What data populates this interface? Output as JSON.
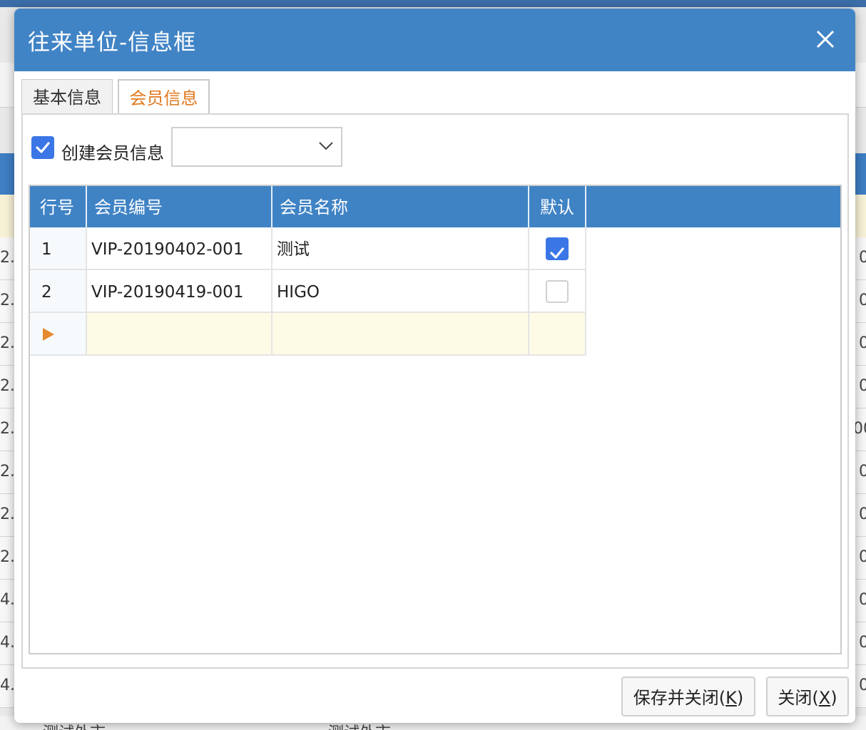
{
  "background": {
    "row_left_fragments": [
      "2.",
      "2.",
      "2.",
      "2.",
      "2.",
      "2.",
      "2.",
      "2.",
      "4.",
      "4.",
      "4."
    ],
    "row_right_fragments": [
      "0",
      "0",
      "0",
      "0",
      "00",
      "0",
      "0",
      "0",
      "0",
      "0",
      "0"
    ],
    "bottom_fragment_left": "测试外市",
    "bottom_fragment_right": "测试外市"
  },
  "dialog": {
    "title": "往来单位-信息框",
    "tabs": [
      {
        "label": "基本信息",
        "active": false
      },
      {
        "label": "会员信息",
        "active": true
      }
    ],
    "create_member": {
      "label": "创建会员信息",
      "checked": true,
      "select_value": ""
    },
    "grid": {
      "columns": [
        "行号",
        "会员编号",
        "会员名称",
        "默认"
      ],
      "rows": [
        {
          "row_no": "1",
          "member_no": "VIP-20190402-001",
          "member_name": "测试",
          "default": true
        },
        {
          "row_no": "2",
          "member_no": "VIP-20190419-001",
          "member_name": "HIGO",
          "default": false
        }
      ]
    },
    "buttons": {
      "save_close_prefix": "保存并关闭(",
      "save_close_key": "K",
      "save_close_suffix": ")",
      "close_prefix": "关闭(",
      "close_key": "X",
      "close_suffix": ")"
    }
  },
  "colors": {
    "header_blue": "#4184c6",
    "active_tab_text": "#e07a20",
    "checkbox_blue": "#3a76e5",
    "new_row_yellow": "#fdfbe6"
  }
}
